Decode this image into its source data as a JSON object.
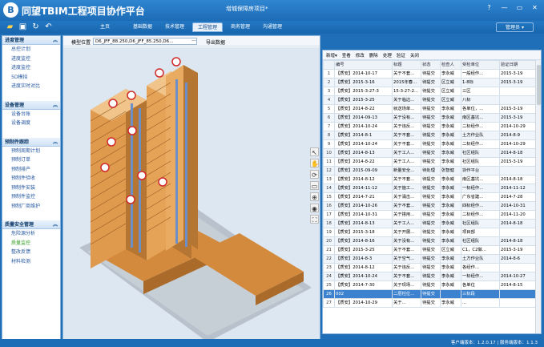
{
  "window": {
    "logo": "B",
    "app_title": "同望TBIM工程项目协作平台",
    "project_name": "增城保障房项目*",
    "buttons": [
      "?",
      "—",
      "▭",
      "✕"
    ]
  },
  "navbar": {
    "quick_icons": [
      "folder-open-icon",
      "save-icon",
      "refresh-icon",
      "undo-icon"
    ],
    "tabs": [
      {
        "label": "主页",
        "active": false
      },
      {
        "label": "基础数据",
        "active": false
      },
      {
        "label": "技术管理",
        "active": false
      },
      {
        "label": "工程管理",
        "active": true
      },
      {
        "label": "商务管理",
        "active": false
      },
      {
        "label": "沟通管理",
        "active": false
      }
    ],
    "admin": "管理员 ▾"
  },
  "sidebar": {
    "groups": [
      {
        "title": "进度管理",
        "items": [
          "总控计划",
          "进度监控",
          "进度监控",
          "5D模拟",
          "进度实时对比"
        ],
        "selected": -1
      },
      {
        "title": "设备管理",
        "items": [
          "设备台账",
          "设备调度"
        ],
        "selected": -1
      },
      {
        "title": "预制件跟踪",
        "items": [
          "预制周期计划",
          "预制订单",
          "预制排产",
          "预制件验收",
          "预制件安装",
          "预制件监控",
          "预制厂商维护"
        ],
        "selected": -1
      },
      {
        "title": "质量安全管理",
        "items": [
          "危险源分析",
          "质量监控",
          "整改反馈",
          "材料检测"
        ],
        "selected": 1
      }
    ]
  },
  "model_view": {
    "label": "模型位置",
    "model_path": "D6_JFF_88.250,D6_JFF_85.250,D6...",
    "dropdown_arrow": "···",
    "export_label": "导出数据",
    "tool_icons": [
      "select-arrow-icon",
      "hand-pan-icon",
      "rotate-icon",
      "camera-icon",
      "zoom-icon",
      "orbit-icon",
      "fit-view-icon"
    ]
  },
  "issues": {
    "toolbar": [
      "新增▾",
      "查看",
      "修改",
      "删除",
      "处理",
      "验证",
      "关闭"
    ],
    "columns": [
      "",
      "编号",
      "标题",
      "状态",
      "检查人",
      "受检单位",
      "验证日期"
    ],
    "rows": [
      [
        "1",
        "【质安】2014-10-17",
        "关于不套...",
        "待提交",
        "李永威",
        "一般经作...",
        "2015-3-19"
      ],
      [
        "2",
        "【质安】2015-3-16",
        "2015年春...",
        "待提交",
        "区立威",
        "1-8标",
        "2015-3-19"
      ],
      [
        "3",
        "【质安】2015-3-27-3",
        "15-3-27-2...",
        "待提交",
        "区立威",
        "三区",
        ""
      ],
      [
        "4",
        "【质安】2015-3-25",
        "关于临边...",
        "待提交",
        "区立威",
        "八标",
        ""
      ],
      [
        "5",
        "【质安】2014-8-22",
        "就送场单...",
        "待提交",
        "李永威",
        "各单位，...",
        "2015-3-19"
      ],
      [
        "6",
        "【质安】2014-09-13",
        "关于没有...",
        "待提交",
        "李永威",
        "南区基坑...",
        "2015-3-19"
      ],
      [
        "7",
        "【质安】2014-10-24",
        "关于违反...",
        "待提交",
        "李永威",
        "二标经作...",
        "2014-10-29"
      ],
      [
        "8",
        "【质安】2014-8-1",
        "关于不套...",
        "待提交",
        "李永威",
        "土方作业队",
        "2014-8-9"
      ],
      [
        "9",
        "【质安】2014-10-24",
        "关于不套...",
        "待提交",
        "李永威",
        "二标经作...",
        "2014-10-29"
      ],
      [
        "10",
        "【质安】2014-8-13",
        "关于工人...",
        "待提交",
        "李永威",
        "社区组队",
        "2014-8-18"
      ],
      [
        "11",
        "【质安】2014-8-22",
        "关于工人...",
        "待提交",
        "李永威",
        "社区组队",
        "2015-3-19"
      ],
      [
        "12",
        "【质安】2015-09-09",
        "新量安全...",
        "待处理",
        "张智健",
        "协作平台",
        ""
      ],
      [
        "13",
        "【质安】2014-8-12",
        "关于不套...",
        "待提交",
        "李永威",
        "南区基坑...",
        "2014-8-18"
      ],
      [
        "14",
        "【质安】2014-11-12",
        "关于施工...",
        "待提交",
        "李永威",
        "一标经作...",
        "2014-11-12"
      ],
      [
        "15",
        "【质安】2014-7-21",
        "关于涌击...",
        "待提交",
        "李永威",
        "广东省建...",
        "2014-7-28"
      ],
      [
        "16",
        "【质安】2014-10-26",
        "关于不套...",
        "待提交",
        "李永威",
        "四标经作...",
        "2014-10-31"
      ],
      [
        "17",
        "【质安】2014-10-31",
        "关于搭用...",
        "待提交",
        "李永威",
        "二标经作...",
        "2014-11-20"
      ],
      [
        "18",
        "【质安】2014-8-13",
        "关于工人...",
        "待提交",
        "李永威",
        "社区组队",
        "2014-8-18"
      ],
      [
        "19",
        "【质安】2015-3-18",
        "关于开展...",
        "待提交",
        "李永威",
        "项目部",
        ""
      ],
      [
        "20",
        "【质安】2014-8-16",
        "关于没有...",
        "待提交",
        "李永威",
        "社区组队",
        "2014-8-18"
      ],
      [
        "21",
        "【质安】2015-3-25",
        "关于不套...",
        "待提交",
        "区立威",
        "C1，C2做...",
        "2015-3-19"
      ],
      [
        "22",
        "【质安】2014-8-3",
        "关于空气...",
        "待提交",
        "李永威",
        "土方作业队",
        "2014-8-6"
      ],
      [
        "23",
        "【质安】2014-8-12",
        "关于违反...",
        "待提交",
        "李永威",
        "各经作...",
        ""
      ],
      [
        "24",
        "【质安】2014-10-24",
        "关于不套...",
        "待提交",
        "李永威",
        "一标经作...",
        "2014-10-27"
      ],
      [
        "25",
        "【质安】2014-7-30",
        "关于现场...",
        "待提交",
        "李永威",
        "各单位",
        "2014-8-15"
      ],
      [
        "26",
        "002",
        "二层柱位...",
        "待提交",
        "",
        "三标段",
        ""
      ],
      [
        "27",
        "【质安】2014-10-29",
        "关于...",
        "待提交",
        "李永威",
        "...",
        ""
      ]
    ],
    "selected_row": 25
  },
  "status": {
    "text": "客户端版本：1.2.0.17  |  服务端版本：1.1.3"
  }
}
